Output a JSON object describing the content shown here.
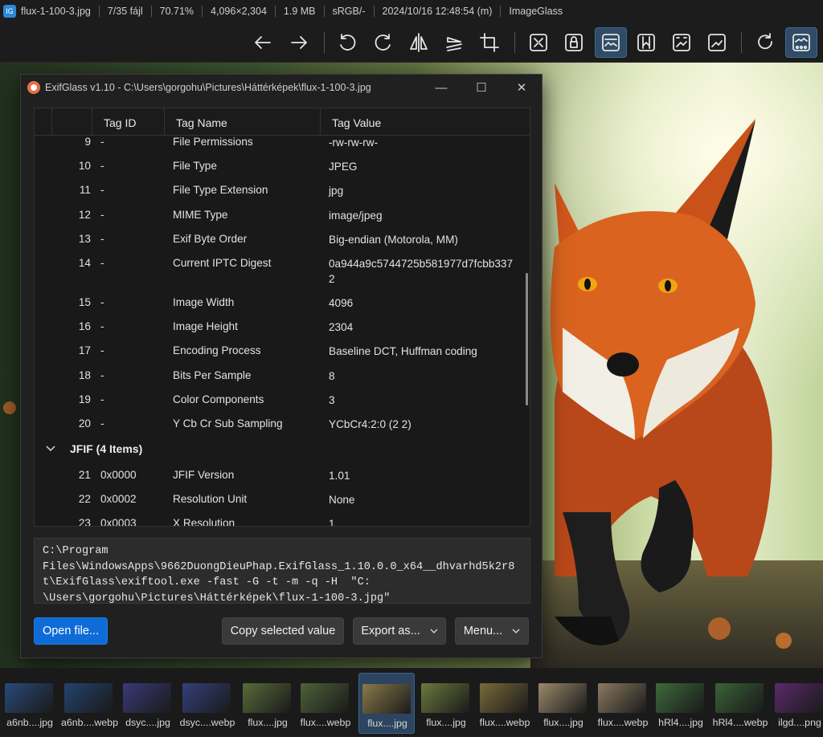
{
  "titlebar": {
    "filename": "flux-1-100-3.jpg",
    "position": "7/35 fájl",
    "zoom": "70.71%",
    "dimensions": "4,096×2,304",
    "filesize": "1.9 MB",
    "colorprofile": "sRGB/-",
    "datetime": "2024/10/16 12:48:54 (m)",
    "app": "ImageGlass"
  },
  "toolbar": {
    "icons": [
      "arrow-left-icon",
      "arrow-right-icon",
      "rotate-left-icon",
      "rotate-right-icon",
      "flip-horizontal-icon",
      "flip-vertical-icon",
      "crop-icon",
      "zoom-fit-icon",
      "lock-zoom-icon",
      "scale-to-width-icon",
      "scale-to-height-icon",
      "scale-to-fill-icon",
      "zoom-icon",
      "refresh-icon",
      "gallery-icon"
    ]
  },
  "dialog": {
    "title": "ExifGlass v1.10 - C:\\Users\\gorgohu\\Pictures\\Háttérképek\\flux-1-100-3.jpg",
    "columns": [
      "",
      "Tag ID",
      "Tag Name",
      "Tag Value"
    ],
    "rows_top": [
      {
        "num": "9",
        "id": "-",
        "name": "File Permissions",
        "value": "-rw-rw-rw-"
      },
      {
        "num": "10",
        "id": "-",
        "name": "File Type",
        "value": "JPEG"
      },
      {
        "num": "11",
        "id": "-",
        "name": "File Type Extension",
        "value": "jpg"
      },
      {
        "num": "12",
        "id": "-",
        "name": "MIME Type",
        "value": "image/jpeg"
      },
      {
        "num": "13",
        "id": "-",
        "name": "Exif Byte Order",
        "value": "Big-endian (Motorola, MM)"
      },
      {
        "num": "14",
        "id": "-",
        "name": "Current IPTC Digest",
        "value": "0a944a9c5744725b581977d7fcbb337\n2"
      },
      {
        "num": "15",
        "id": "-",
        "name": "Image Width",
        "value": "4096"
      },
      {
        "num": "16",
        "id": "-",
        "name": "Image Height",
        "value": "2304"
      },
      {
        "num": "17",
        "id": "-",
        "name": "Encoding Process",
        "value": "Baseline DCT, Huffman coding"
      },
      {
        "num": "18",
        "id": "-",
        "name": "Bits Per Sample",
        "value": "8"
      },
      {
        "num": "19",
        "id": "-",
        "name": "Color Components",
        "value": "3"
      },
      {
        "num": "20",
        "id": "-",
        "name": "Y Cb Cr Sub Sampling",
        "value": "YCbCr4:2:0 (2 2)"
      }
    ],
    "group_label": "JFIF (4 Items)",
    "rows_bottom": [
      {
        "num": "21",
        "id": "0x0000",
        "name": "JFIF Version",
        "value": "1.01"
      },
      {
        "num": "22",
        "id": "0x0002",
        "name": "Resolution Unit",
        "value": "None"
      },
      {
        "num": "23",
        "id": "0x0003",
        "name": "X Resolution",
        "value": "1"
      }
    ],
    "command": "C:\\Program\nFiles\\WindowsApps\\9662DuongDieuPhap.ExifGlass_1.10.0.0_x64__dhvarhd5k2r8\nt\\ExifGlass\\exiftool.exe -fast -G -t -m -q -H  \"C:\n\\Users\\gorgohu\\Pictures\\Háttérképek\\flux-1-100-3.jpg\"",
    "buttons": {
      "open": "Open file...",
      "copy": "Copy selected value",
      "export": "Export as...",
      "menu": "Menu..."
    }
  },
  "thumbnails": [
    {
      "label": "a6nb....jpg",
      "color": "#2a4a7a"
    },
    {
      "label": "a6nb....webp",
      "color": "#24436e"
    },
    {
      "label": "dsyc....jpg",
      "color": "#3a3a78"
    },
    {
      "label": "dsyc....webp",
      "color": "#34407a"
    },
    {
      "label": "flux....jpg",
      "color": "#5a6b3a"
    },
    {
      "label": "flux....webp",
      "color": "#4e6238"
    },
    {
      "label": "flux....jpg",
      "color": "#8a7a4a",
      "selected": true
    },
    {
      "label": "flux....jpg",
      "color": "#6a7a3e"
    },
    {
      "label": "flux....webp",
      "color": "#7a6a3a"
    },
    {
      "label": "flux....jpg",
      "color": "#9a8a6a"
    },
    {
      "label": "flux....webp",
      "color": "#8a7a62"
    },
    {
      "label": "hRl4....jpg",
      "color": "#3e6a3a"
    },
    {
      "label": "hRl4....webp",
      "color": "#3a6236"
    },
    {
      "label": "ilgd....png",
      "color": "#5a2a6a"
    }
  ]
}
